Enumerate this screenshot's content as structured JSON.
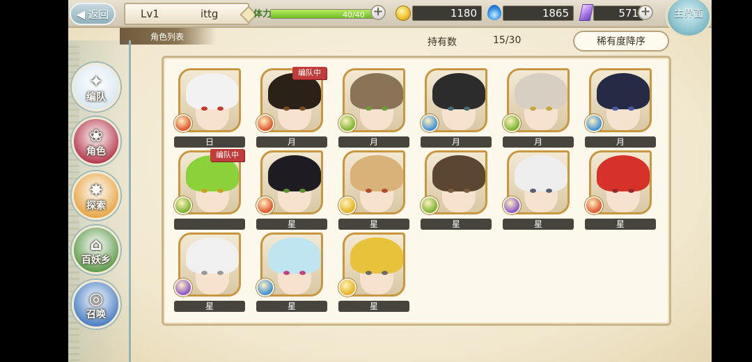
{
  "header": {
    "back_label": "返回",
    "level": "Lv1",
    "player_name": "ittg",
    "stamina_label": "体力",
    "stamina_value": "40/40",
    "stamina_fraction": 1.0,
    "gold": "1180",
    "spirit": "1865",
    "crystal": "571",
    "home_label": "主界面"
  },
  "subheader": {
    "tab_label": "角色列表",
    "owned_label": "持有数",
    "owned_count": "15/30",
    "sort_label": "稀有度降序"
  },
  "sidebar": {
    "items": [
      {
        "label": "编队",
        "icon": "formation-icon",
        "color": "#d9e8f2"
      },
      {
        "label": "角色",
        "icon": "character-icon",
        "color": "#b63a4f"
      },
      {
        "label": "探索",
        "icon": "explore-icon",
        "color": "#e7a545"
      },
      {
        "label": "百妖乡",
        "icon": "village-icon",
        "color": "#5f9c4e"
      },
      {
        "label": "召唤",
        "icon": "summon-icon",
        "color": "#4a7fc4"
      }
    ]
  },
  "characters": [
    {
      "rarity": "日",
      "attribute": "fire-icon",
      "attr_color": "#e0542c",
      "hair": "#f2f2f2",
      "eye": "#c43b2c",
      "in_team": false
    },
    {
      "rarity": "月",
      "attribute": "fire-icon",
      "attr_color": "#e0542c",
      "hair": "#2a2118",
      "eye": "#7a4b1f",
      "in_team": true
    },
    {
      "rarity": "月",
      "attribute": "wind-icon",
      "attr_color": "#79b22e",
      "hair": "#8a7458",
      "eye": "#6b9e3a",
      "in_team": false
    },
    {
      "rarity": "月",
      "attribute": "water-icon",
      "attr_color": "#3d8fd6",
      "hair": "#2c2c2c",
      "eye": "#3f6a6e",
      "in_team": false
    },
    {
      "rarity": "月",
      "attribute": "wind-icon",
      "attr_color": "#79b22e",
      "hair": "#d7cfc2",
      "eye": "#c4a93a",
      "in_team": false
    },
    {
      "rarity": "月",
      "attribute": "water-icon",
      "attr_color": "#3d8fd6",
      "hair": "#252a45",
      "eye": "#4a58a8",
      "in_team": false
    },
    {
      "rarity": "",
      "attribute": "wind-icon",
      "attr_color": "#79b22e",
      "hair": "#8bd23a",
      "eye": "#c9a320",
      "in_team": true
    },
    {
      "rarity": "星",
      "attribute": "fire-icon",
      "attr_color": "#e0542c",
      "hair": "#1e1c22",
      "eye": "#5a8f2e",
      "in_team": false
    },
    {
      "rarity": "星",
      "attribute": "light-icon",
      "attr_color": "#e3b21c",
      "hair": "#d9b27a",
      "eye": "#b04a2a",
      "in_team": false
    },
    {
      "rarity": "星",
      "attribute": "wind-icon",
      "attr_color": "#79b22e",
      "hair": "#5b4632",
      "eye": "#7a5b3a",
      "in_team": false
    },
    {
      "rarity": "星",
      "attribute": "dark-icon",
      "attr_color": "#8a55c9",
      "hair": "#eeeeee",
      "eye": "#556070",
      "in_team": false
    },
    {
      "rarity": "星",
      "attribute": "fire-icon",
      "attr_color": "#e0542c",
      "hair": "#d6322a",
      "eye": "#9a2a2a",
      "in_team": false
    },
    {
      "rarity": "星",
      "attribute": "dark-icon",
      "attr_color": "#8a55c9",
      "hair": "#f0f0f0",
      "eye": "#9a9a9a",
      "in_team": false
    },
    {
      "rarity": "星",
      "attribute": "water-icon",
      "attr_color": "#3d8fd6",
      "hair": "#bfe6f0",
      "eye": "#c4427a",
      "in_team": false
    },
    {
      "rarity": "星",
      "attribute": "light-icon",
      "attr_color": "#e3b21c",
      "hair": "#e8c23a",
      "eye": "#6a6a6a",
      "in_team": false
    }
  ],
  "team_badge": "编队中"
}
